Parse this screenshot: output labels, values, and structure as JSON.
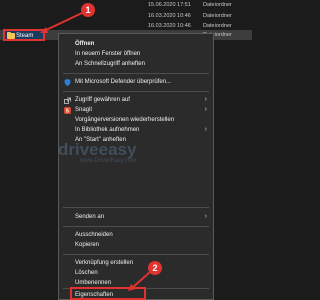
{
  "explorer": {
    "rows": [
      {
        "date": "15.06.2020 17:51",
        "type": "Dateiordner"
      },
      {
        "date": "16.03.2020 10:46",
        "type": "Dateiordner"
      },
      {
        "date": "16.03.2020 10:46",
        "type": "Dateiordner"
      },
      {
        "name": "Steam",
        "date": "",
        "type": "Dateiordner"
      }
    ]
  },
  "context_menu": {
    "open": "Öffnen",
    "open_new_window": "In neuem Fenster öffnen",
    "pin_quick_access": "An Schnellzugriff anheften",
    "defender_scan": "Mit Microsoft Defender überprüfen...",
    "give_access": "Zugriff gewähren auf",
    "snagit": "Snagit",
    "restore_versions": "Vorgängerversionen wiederherstellen",
    "include_library": "In Bibliothek aufnehmen",
    "pin_start": "An \"Start\" anheften",
    "send_to": "Senden an",
    "cut": "Ausschneiden",
    "copy": "Kopieren",
    "create_shortcut": "Verknüpfung erstellen",
    "delete": "Löschen",
    "rename": "Umbenennen",
    "properties": "Eigenschaften"
  },
  "annotations": {
    "badge1": "1",
    "badge2": "2"
  },
  "watermark": {
    "main": "driveeasy",
    "sub": "www.DriverEasy.com"
  },
  "colors": {
    "highlight": "#e0322f",
    "menu_bg": "#2b2b2b",
    "folder": "#f2c55a"
  }
}
